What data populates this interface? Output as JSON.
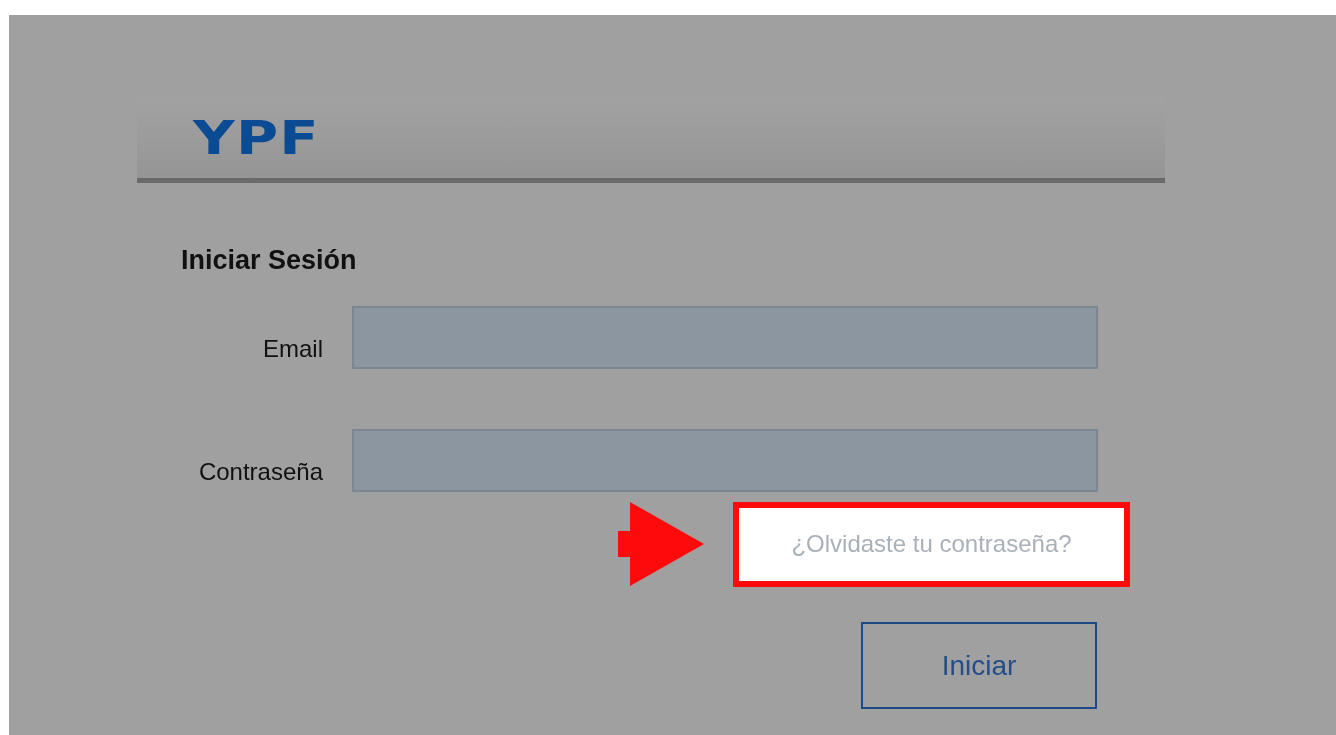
{
  "header": {
    "logo": "YPF"
  },
  "title": "Iniciar Sesión",
  "fields": [
    {
      "label": "Email"
    },
    {
      "label": "Contraseña"
    }
  ],
  "forgot_link": "¿Olvidaste tu contraseña?",
  "submit": "Iniciar"
}
